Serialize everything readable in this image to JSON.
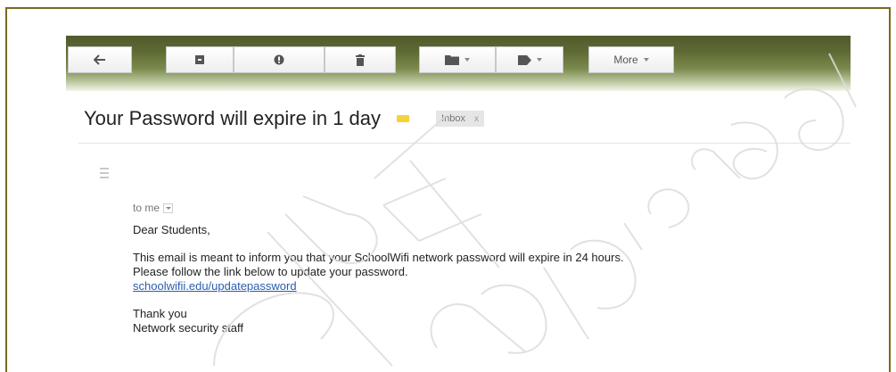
{
  "toolbar": {
    "buttons": [
      {
        "name": "back-arrow-icon"
      },
      {
        "name": "archive-icon"
      },
      {
        "name": "report-spam-icon"
      },
      {
        "name": "delete-icon"
      },
      {
        "name": "folder-icon"
      },
      {
        "name": "label-tag-icon"
      }
    ],
    "more_label": "More"
  },
  "email": {
    "subject": "Your Password will expire in 1 day",
    "label": "Inbox",
    "label_close": "x",
    "to": "to me",
    "greeting": "Dear Students,",
    "body_line1": "This email is meant to inform you that your SchoolWifi network password will expire in 24 hours.",
    "body_line2": "Please follow the link below to update your password.",
    "link": "schoolwifii.edu/updatepassword",
    "closing": "Thank you",
    "signature": "Network security staff"
  },
  "colors": {
    "border": "#7a6a1c",
    "toolbar_green": "#5f6b34",
    "label_yellow": "#f5d23a",
    "link_blue": "#2a5db0"
  }
}
